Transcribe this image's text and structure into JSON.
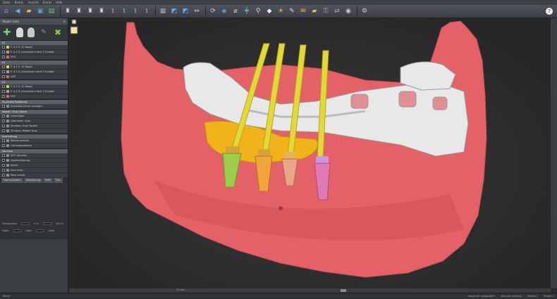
{
  "menu": [
    "Datei",
    "Bearb.",
    "Ansicht",
    "Extras",
    "Hilfe"
  ],
  "toolbar_icons": [
    "home-icon",
    "back-icon",
    "folder-icon",
    "save-icon",
    "layers-icon",
    "tooth-tool-icon",
    "tooth-tool-icon",
    "tooth-tool-icon",
    "tooth-tool-icon",
    "implant-icon",
    "implant-icon",
    "implant-icon",
    "implant-icon",
    "grid-icon",
    "select-icon",
    "select-icon",
    "measure-icon",
    "rotate-icon",
    "view-icon",
    "sleeve-icon",
    "ruler-icon",
    "pin-icon",
    "shield-icon",
    "light-icon",
    "pencil-icon",
    "note-icon",
    "folder-icon",
    "key-icon",
    "sync-icon",
    "camera-icon",
    "settings-icon",
    "help-icon"
  ],
  "left_panel": {
    "title": "Objekt-Liste",
    "sections": [
      {
        "head": "01",
        "rows": [
          "F: 4.1 S. 12 Rapid",
          "F: 4.1 S. Connector Insert 3 Guided",
          "VSP"
        ]
      },
      {
        "head": "02",
        "rows": [
          "F: 4.1 S. 12 Rapid",
          "F: 4.1 S. Connector Insert 3 Guided",
          "VSP"
        ]
      },
      {
        "head": "03",
        "rows": [
          "F: 4.1 S. 12 Rapid",
          "F: 4.1 S. Connector Insert 3 Guided",
          "VSP"
        ]
      },
      {
        "head": "Implantat Positionen",
        "rows": [
          "Implantat-Achse anzeigen"
        ]
      },
      {
        "head": "Modell / Scan Daten",
        "rows": [
          "Unterkiefer",
          "Oberkiefer Scan",
          "Situation Scan Modell",
          "Situation Modell Scan"
        ]
      },
      {
        "head": "Ausrichtung",
        "rows": [
          "Referenzebene",
          "Okklusionsebene"
        ]
      },
      {
        "head": "Volumen",
        "rows": [
          "DVT Volumen",
          "Segmentierung",
          "Kiefer",
          "Nerv links",
          "Nerv rechts"
        ]
      }
    ],
    "tabs": [
      "Eigenschaften",
      "Darstellung",
      "Hilfe",
      "Info"
    ],
    "props": [
      {
        "label": "Transparenz",
        "v1": "0 %",
        "v2": "100 %"
      },
      {
        "label": "Farbe",
        "v1": "Auto",
        "v2": "Auto"
      }
    ]
  },
  "viewport": {
    "scale_label": "10 mm"
  },
  "status": {
    "left": "Bereit",
    "right": [
      "Implantat ausgewählt",
      "Volumen sichtbar",
      "Modell 1",
      "Modell 2"
    ]
  },
  "colors": {
    "bone": "#e36167",
    "guide": "#e8e8e8",
    "pin": "#e2d83a",
    "implant_green": "#9ccc4a",
    "implant_orange": "#f0a53c",
    "implant_pink": "#e07ab4"
  }
}
